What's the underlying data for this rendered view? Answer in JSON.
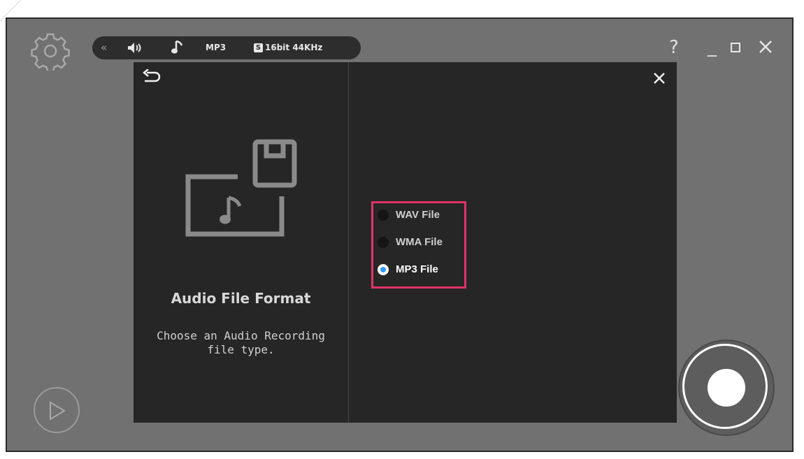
{
  "toolbar": {
    "collapse_icon": "double-chevron-left-icon",
    "speaker_icon": "speaker-icon",
    "note_icon": "music-note-icon",
    "format": "MP3",
    "badge": "S",
    "quality": "16bit 44KHz"
  },
  "window_controls": {
    "help": "?",
    "minimize": "_"
  },
  "panel": {
    "title": "Audio File Format",
    "description": "Choose an Audio Recording file type.",
    "options": [
      {
        "label": "WAV File",
        "selected": false
      },
      {
        "label": "WMA File",
        "selected": false
      },
      {
        "label": "MP3 File",
        "selected": true
      }
    ]
  },
  "colors": {
    "highlight": "#e0336a",
    "radio_selected": "#2f9bff",
    "panel_bg": "#262626",
    "window_bg": "#717171"
  }
}
